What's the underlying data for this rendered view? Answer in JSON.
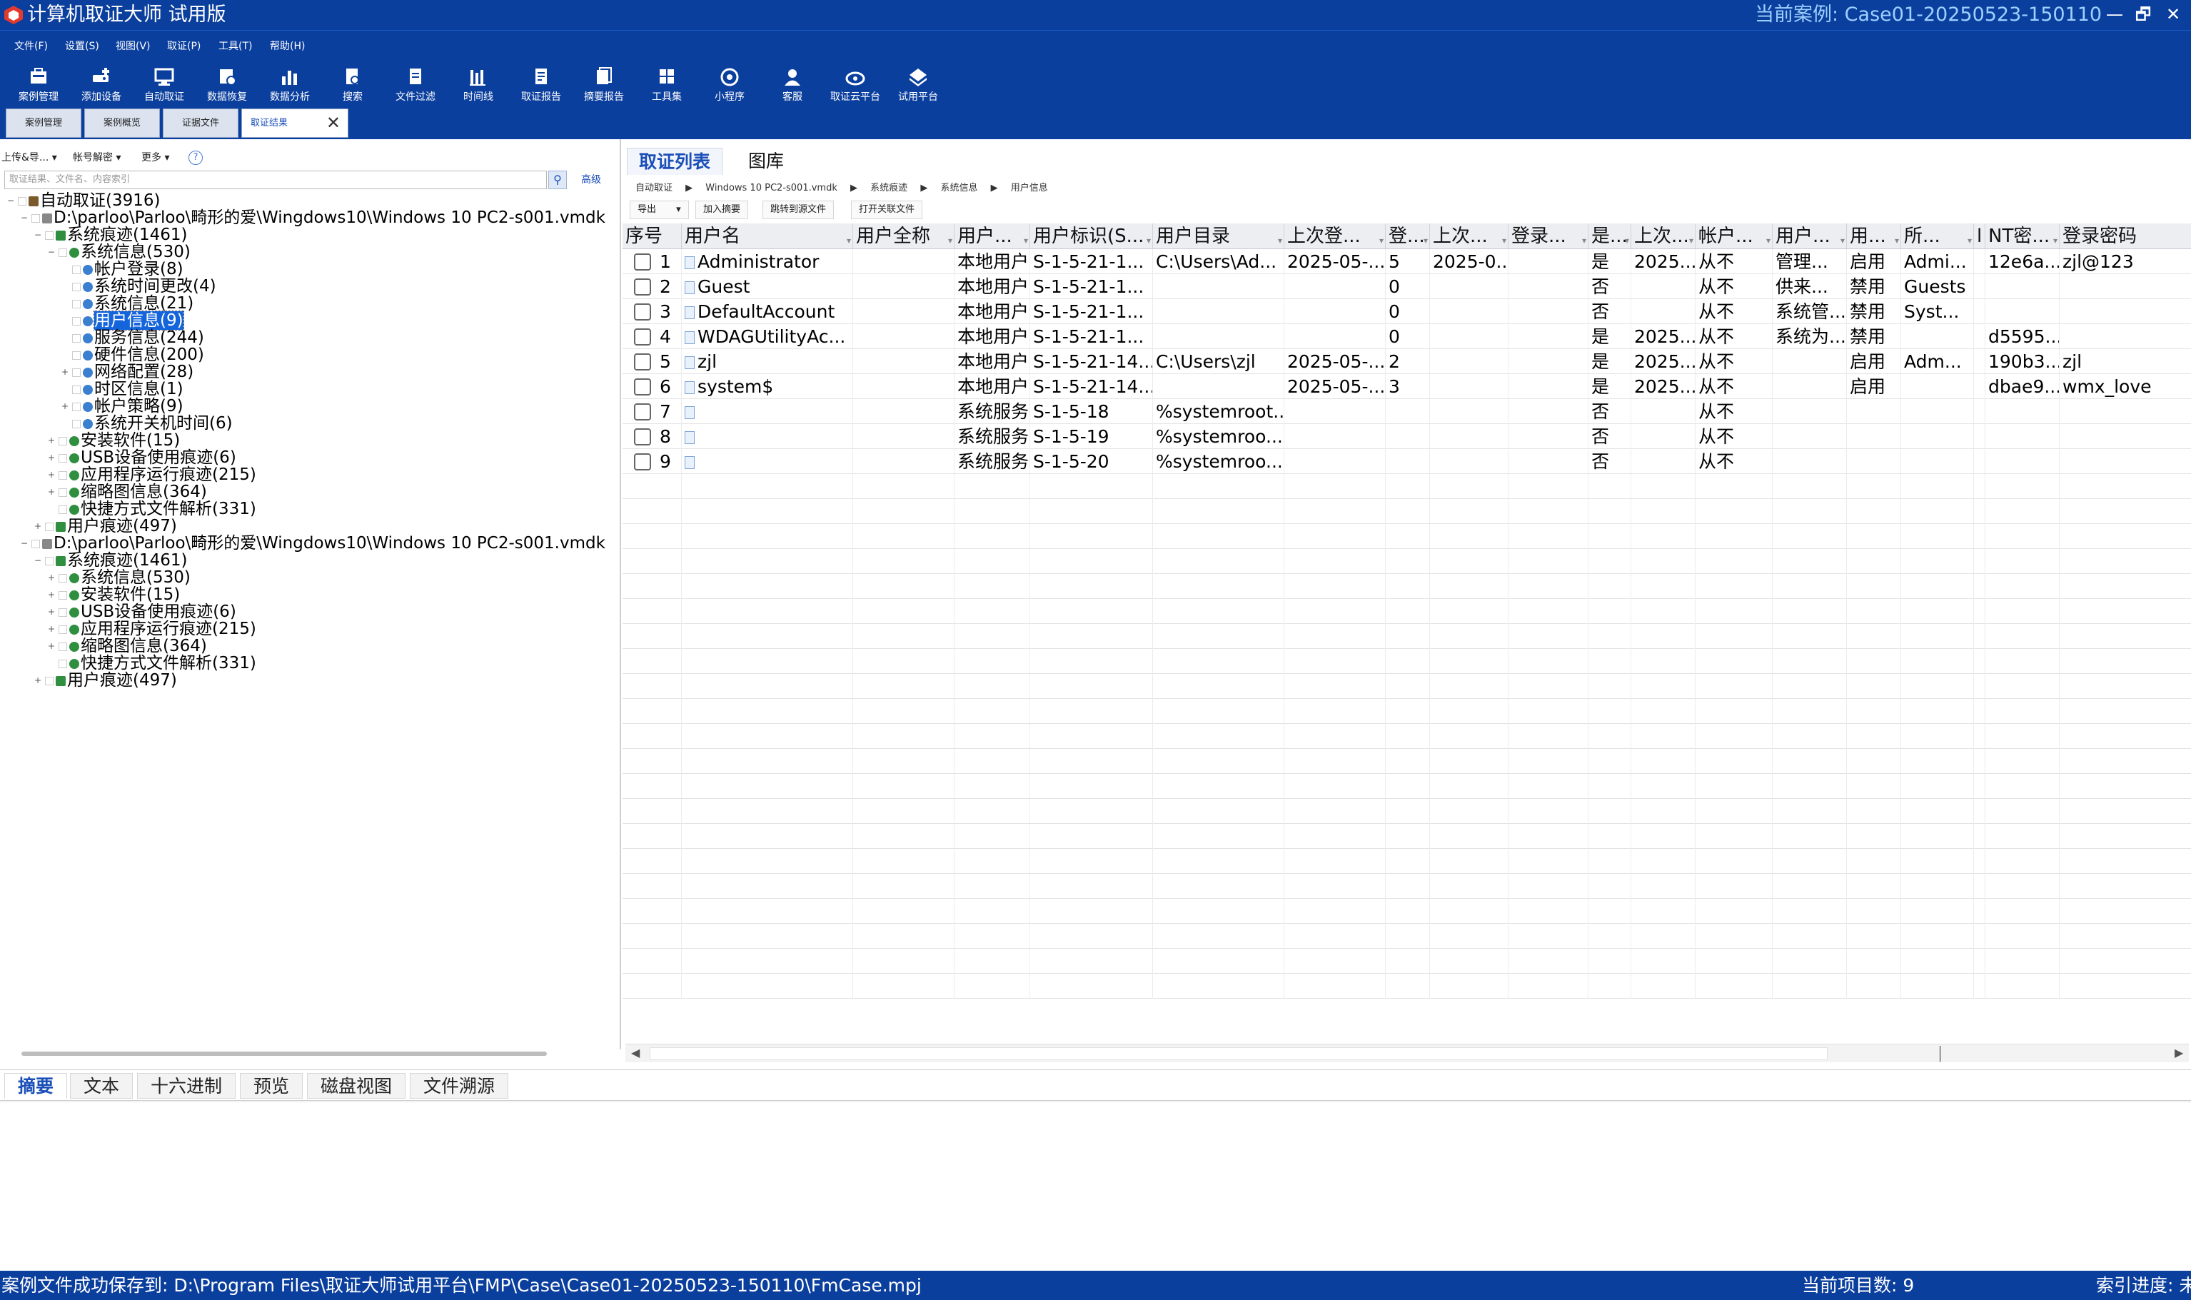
{
  "title": {
    "app": "计算机取证大师 试用版",
    "case": "当前案例:  Case01-20250523-150110"
  },
  "window_buttons": [
    "—",
    "🗗",
    "✕"
  ],
  "menu": [
    "文件(F)",
    "设置(S)",
    "视图(V)",
    "取证(P)",
    "工具(T)",
    "帮助(H)"
  ],
  "toolbar": [
    {
      "label": "案例管理",
      "icon": "case-icon"
    },
    {
      "label": "添加设备",
      "icon": "add-device-icon"
    },
    {
      "label": "自动取证",
      "icon": "monitor-icon"
    },
    {
      "label": "数据恢复",
      "icon": "recover-icon"
    },
    {
      "label": "数据分析",
      "icon": "chart-icon"
    },
    {
      "label": "搜索",
      "icon": "search-doc-icon"
    },
    {
      "label": "文件过滤",
      "icon": "filter-icon"
    },
    {
      "label": "时间线",
      "icon": "timeline-icon"
    },
    {
      "label": "取证报告",
      "icon": "report-icon"
    },
    {
      "label": "摘要报告",
      "icon": "summary-icon"
    },
    {
      "label": "工具集",
      "icon": "tools-icon"
    },
    {
      "label": "小程序",
      "icon": "miniapp-icon"
    },
    {
      "label": "客服",
      "icon": "support-icon"
    },
    {
      "label": "取证云平台",
      "icon": "cloud-icon"
    },
    {
      "label": "试用平台",
      "icon": "trial-icon"
    }
  ],
  "doc_tabs": [
    "案例管理",
    "案例概览",
    "证据文件",
    "取证结果"
  ],
  "left": {
    "buttons": [
      "上传&导...",
      "帐号解密",
      "更多"
    ],
    "search_placeholder": "取证结果、文件名、内容索引",
    "advanced": "高级",
    "tree": [
      {
        "label": "自动取证(3916)",
        "level": 0,
        "exp": "−"
      },
      {
        "label": "D:\\parloo\\Parloo\\畸形的爱\\Wingdows10\\Windows 10 PC2-s001.vmdk",
        "level": 1,
        "exp": "−"
      },
      {
        "label": "系统痕迹(1461)",
        "level": 2,
        "exp": "−"
      },
      {
        "label": "系统信息(530)",
        "level": 3,
        "exp": "−"
      },
      {
        "label": "帐户登录(8)",
        "level": 4,
        "exp": ""
      },
      {
        "label": "系统时间更改(4)",
        "level": 4,
        "exp": ""
      },
      {
        "label": "系统信息(21)",
        "level": 4,
        "exp": ""
      },
      {
        "label": "用户信息(9)",
        "level": 4,
        "exp": "",
        "selected": true
      },
      {
        "label": "服务信息(244)",
        "level": 4,
        "exp": ""
      },
      {
        "label": "硬件信息(200)",
        "level": 4,
        "exp": ""
      },
      {
        "label": "网络配置(28)",
        "level": 4,
        "exp": "+"
      },
      {
        "label": "时区信息(1)",
        "level": 4,
        "exp": ""
      },
      {
        "label": "帐户策略(9)",
        "level": 4,
        "exp": "+"
      },
      {
        "label": "系统开关机时间(6)",
        "level": 4,
        "exp": ""
      },
      {
        "label": "安装软件(15)",
        "level": 3,
        "exp": "+"
      },
      {
        "label": "USB设备使用痕迹(6)",
        "level": 3,
        "exp": "+"
      },
      {
        "label": "应用程序运行痕迹(215)",
        "level": 3,
        "exp": "+"
      },
      {
        "label": "缩略图信息(364)",
        "level": 3,
        "exp": "+"
      },
      {
        "label": "快捷方式文件解析(331)",
        "level": 3,
        "exp": ""
      },
      {
        "label": "用户痕迹(497)",
        "level": 2,
        "exp": "+"
      },
      {
        "label": "D:\\parloo\\Parloo\\畸形的爱\\Wingdows10\\Windows 10 PC2-s001.vmdk",
        "level": 1,
        "exp": "−"
      },
      {
        "label": "系统痕迹(1461)",
        "level": 2,
        "exp": "−"
      },
      {
        "label": "系统信息(530)",
        "level": 3,
        "exp": "+"
      },
      {
        "label": "安装软件(15)",
        "level": 3,
        "exp": "+"
      },
      {
        "label": "USB设备使用痕迹(6)",
        "level": 3,
        "exp": "+"
      },
      {
        "label": "应用程序运行痕迹(215)",
        "level": 3,
        "exp": "+"
      },
      {
        "label": "缩略图信息(364)",
        "level": 3,
        "exp": "+"
      },
      {
        "label": "快捷方式文件解析(331)",
        "level": 3,
        "exp": ""
      },
      {
        "label": "用户痕迹(497)",
        "level": 2,
        "exp": "+"
      }
    ]
  },
  "right": {
    "tabs": [
      "取证列表",
      "图库"
    ],
    "breadcrumb": [
      "自动取证",
      "Windows 10 PC2-s001.vmdk",
      "系统痕迹",
      "系统信息",
      "用户信息"
    ],
    "actions": [
      "导出",
      "加入摘要",
      "跳转到源文件",
      "打开关联文件"
    ],
    "columns": [
      "序号",
      "用户名",
      "用户全称",
      "用户...",
      "用户标识(S...",
      "用户目录",
      "上次登...",
      "登...",
      "上次...",
      "登录...",
      "是...",
      "上次...",
      "帐户...",
      "用户...",
      "用...",
      "所...",
      "l",
      "NT密...",
      "登录密码"
    ],
    "rows": [
      [
        "1",
        "Administrator",
        "",
        "本地用户",
        "S-1-5-21-1...",
        "C:\\Users\\Ad...",
        "2025-05-...",
        "5",
        "2025-0...",
        "",
        "是",
        "2025...",
        "从不",
        "管理...",
        "启用",
        "Admi...",
        "",
        "12e6a...",
        "zjl@123"
      ],
      [
        "2",
        "Guest",
        "",
        "本地用户",
        "S-1-5-21-1...",
        "",
        "",
        "0",
        "",
        "",
        "否",
        "",
        "从不",
        "供来...",
        "禁用",
        "Guests",
        "",
        "",
        ""
      ],
      [
        "3",
        "DefaultAccount",
        "",
        "本地用户",
        "S-1-5-21-1...",
        "",
        "",
        "0",
        "",
        "",
        "否",
        "",
        "从不",
        "系统管...",
        "禁用",
        "Syst...",
        "",
        "",
        ""
      ],
      [
        "4",
        "WDAGUtilityAc...",
        "",
        "本地用户",
        "S-1-5-21-1...",
        "",
        "",
        "0",
        "",
        "",
        "是",
        "2025...",
        "从不",
        "系统为...",
        "禁用",
        "",
        "",
        "d5595...",
        ""
      ],
      [
        "5",
        "zjl",
        "",
        "本地用户",
        "S-1-5-21-14...",
        "C:\\Users\\zjl",
        "2025-05-...",
        "2",
        "",
        "",
        "是",
        "2025...",
        "从不",
        "",
        "启用",
        "Adm...",
        "",
        "190b3...",
        "zjl"
      ],
      [
        "6",
        "system$",
        "",
        "本地用户",
        "S-1-5-21-14...",
        "",
        "2025-05-...",
        "3",
        "",
        "",
        "是",
        "2025...",
        "从不",
        "",
        "启用",
        "",
        "",
        "dbae9...",
        "wmx_love"
      ],
      [
        "7",
        "",
        "",
        "系统服务",
        "S-1-5-18",
        "%systemroot...",
        "",
        "",
        "",
        "",
        "否",
        "",
        "从不",
        "",
        "",
        "",
        "",
        "",
        ""
      ],
      [
        "8",
        "",
        "",
        "系统服务",
        "S-1-5-19",
        "%systemroo...",
        "",
        "",
        "",
        "",
        "否",
        "",
        "从不",
        "",
        "",
        "",
        "",
        "",
        ""
      ],
      [
        "9",
        "",
        "",
        "系统服务",
        "S-1-5-20",
        "%systemroo...",
        "",
        "",
        "",
        "",
        "否",
        "",
        "从不",
        "",
        "",
        "",
        "",
        "",
        ""
      ]
    ]
  },
  "bottom_tabs": [
    "摘要",
    "文本",
    "十六进制",
    "预览",
    "磁盘视图",
    "文件溯源"
  ],
  "status": {
    "left": "案例文件成功保存到:  D:\\Program Files\\取证大师试用平台\\FMP\\Case\\Case01-20250523-150110\\FmCase.mpj",
    "count": "当前项目数: 9",
    "index": "索引进度: 未"
  },
  "colors": {
    "chrome": "#0b3f9e",
    "accent": "#1a4fb8",
    "selection": "#1464dc"
  }
}
